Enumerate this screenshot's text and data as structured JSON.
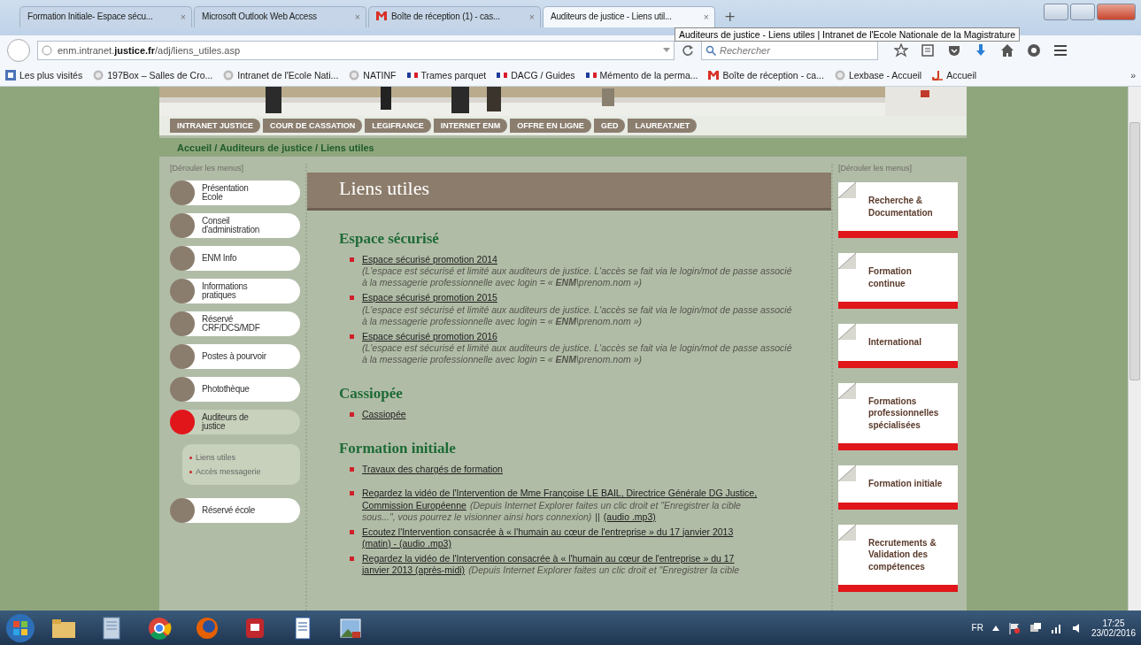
{
  "browser": {
    "tabs": [
      {
        "title": "Formation Initiale- Espace sécu...",
        "kind": "page",
        "close": "×",
        "selected": false
      },
      {
        "title": "Microsoft Outlook Web Access",
        "kind": "page",
        "close": "×",
        "selected": false
      },
      {
        "title": "Boîte de réception (1) - cas...",
        "kind": "mail",
        "close": "×",
        "selected": false
      },
      {
        "title": "Auditeurs de justice - Liens util...",
        "kind": "page",
        "close": "×",
        "selected": true
      }
    ],
    "new_tab": "+",
    "tooltip": "Auditeurs de justice - Liens utiles | Intranet de l'Ecole Nationale de la Magistrature",
    "url": "enm.intranet.**justice.fr**/adj/liens_utiles.asp",
    "search": {
      "placeholder": "Rechercher"
    },
    "bookmarks": [
      {
        "label": "Les plus visités",
        "kind": "star"
      },
      {
        "label": "197Box – Salles de Cro...",
        "kind": "globe"
      },
      {
        "label": "Intranet de l'Ecole Nati...",
        "kind": "globe"
      },
      {
        "label": "NATINF",
        "kind": "globe"
      },
      {
        "label": "Trames parquet",
        "kind": "flag"
      },
      {
        "label": "DACG / Guides",
        "kind": "flag"
      },
      {
        "label": "Mémento de la perma...",
        "kind": "flag"
      },
      {
        "label": "Boîte de réception - ca...",
        "kind": "mail"
      },
      {
        "label": "Lexbase - Accueil",
        "kind": "globe"
      },
      {
        "label": "Accueil",
        "kind": "j"
      }
    ],
    "more": "»"
  },
  "site": {
    "nav": [
      "INTRANET JUSTICE",
      "COUR DE CASSATION",
      "LEGIFRANCE",
      "INTERNET ENM",
      "OFFRE EN LIGNE",
      "GED",
      "LAUREAT.NET"
    ],
    "breadcrumb": "Accueil / Auditeurs de justice / Liens utiles",
    "left_toggle": "[Dérouler les menus]",
    "menu": [
      {
        "label": "Présentation\nEcole",
        "selected": false
      },
      {
        "label": "Conseil\nd'administration",
        "selected": false
      },
      {
        "label": "ENM Info",
        "selected": false
      },
      {
        "label": "Informations\npratiques",
        "selected": false
      },
      {
        "label": "Réservé\nCRF/DCS/MDF",
        "selected": false
      },
      {
        "label": "Postes à pourvoir",
        "selected": false
      },
      {
        "label": "Photothèque",
        "selected": false
      },
      {
        "label": "Auditeurs de\njustice",
        "selected": true,
        "children": [
          "Liens utiles",
          "Accès messagerie"
        ]
      },
      {
        "label": "Réservé école",
        "selected": false
      }
    ],
    "title": "Liens utiles",
    "sections": [
      {
        "heading": "Espace sécurisé",
        "items": [
          [
            [
              {
                "kind": "link",
                "text": "Espace sécurisé promotion 2014"
              }
            ],
            [
              {
                "kind": "note",
                "text": "(L'espace est sécurisé et limité aux auditeurs de justice. L'accès se fait via le login/mot de passe associé à la messagerie professionnelle avec login = « **ENM**\\prenom.nom »)"
              }
            ]
          ],
          [
            [
              {
                "kind": "link",
                "text": "Espace sécurisé promotion 2015"
              }
            ],
            [
              {
                "kind": "note",
                "text": "(L'espace est sécurisé et limité aux auditeurs de justice. L'accès se fait via le login/mot de passe associé à la messagerie professionnelle avec login = « **ENM**\\prenom.nom »)"
              }
            ]
          ],
          [
            [
              {
                "kind": "link",
                "text": "Espace sécurisé promotion 2016"
              }
            ],
            [
              {
                "kind": "note",
                "text": "(L'espace est sécurisé et limité aux auditeurs de justice. L'accès se fait via le login/mot de passe associé à la messagerie professionnelle avec login = « **ENM**\\prenom.nom »)"
              }
            ]
          ]
        ]
      },
      {
        "heading": "Cassiopée",
        "items": [
          [
            [
              {
                "kind": "link",
                "text": "Cassiopée"
              }
            ]
          ]
        ]
      },
      {
        "heading": "Formation initiale",
        "items": [
          [
            [
              {
                "kind": "link",
                "text": "Travaux des chargés de formation"
              }
            ]
          ],
          [
            [
              {
                "kind": "link",
                "text": "Regardez la vidéo de l'Intervention de Mme Françoise LE BAIL, Directrice Générale DG Justice,"
              }
            ],
            [
              {
                "kind": "link",
                "text": "Commission Européenne"
              },
              {
                "kind": "note",
                "text": "(Depuis Internet Explorer faites un clic droit et \"Enregistrer la cible"
              }
            ],
            [
              {
                "kind": "note",
                "text": "sous...\", vous pourrez le visionner ainsi hors connexion)"
              },
              {
                "kind": "text",
                "text": "||"
              },
              {
                "kind": "link",
                "text": "(audio .mp3)"
              }
            ]
          ],
          [
            [
              {
                "kind": "link",
                "text": "Ecoutez l'Intervention consacrée à « l'humain au cœur de l'entreprise » du 17 janvier 2013"
              }
            ],
            [
              {
                "kind": "link",
                "text": "(matin) - (audio .mp3)"
              }
            ]
          ],
          [
            [
              {
                "kind": "link",
                "text": "Regardez la vidéo de l'Intervention consacrée à « l'humain au cœur de l'entreprise » du 17"
              }
            ],
            [
              {
                "kind": "link",
                "text": "janvier 2013 (après-midi)"
              },
              {
                "kind": "note",
                "text": "(Depuis Internet Explorer faites un clic droit et \"Enregistrer la cible"
              }
            ]
          ]
        ]
      }
    ],
    "right_toggle": "[Dérouler les menus]",
    "cards": [
      "Recherche &\nDocumentation",
      "Formation\ncontinue",
      "International",
      "Formations\nprofessionnelles\nspécialisées",
      "Formation initiale",
      "Recrutements &\nValidation des\ncompétences"
    ]
  },
  "taskbar": {
    "lang": "FR",
    "time": "17:25",
    "date": "23/02/2016"
  }
}
